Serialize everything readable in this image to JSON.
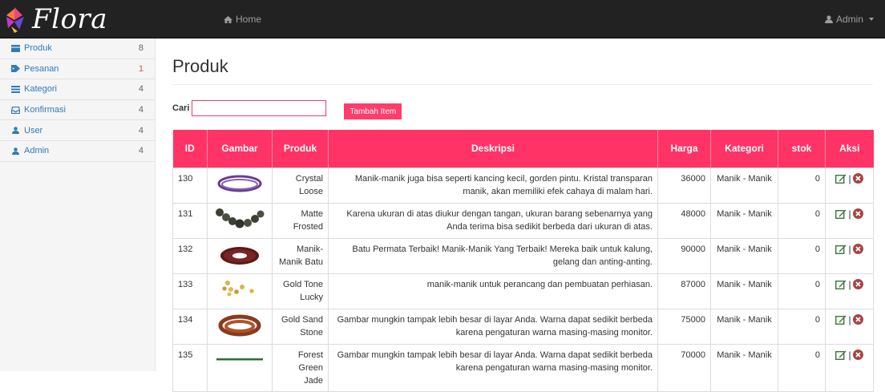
{
  "brand": {
    "name": "Flora"
  },
  "nav": {
    "home_label": "Home",
    "user_label": "Admin"
  },
  "sidebar": {
    "items": [
      {
        "label": "Produk",
        "count": "8",
        "icon": "box-icon"
      },
      {
        "label": "Pesanan",
        "count": "1",
        "icon": "tag-icon"
      },
      {
        "label": "Kategori",
        "count": "4",
        "icon": "list-icon"
      },
      {
        "label": "Konfirmasi",
        "count": "4",
        "icon": "inbox-icon"
      },
      {
        "label": "User",
        "count": "4",
        "icon": "user-icon"
      },
      {
        "label": "Admin",
        "count": "4",
        "icon": "user-icon"
      }
    ]
  },
  "main": {
    "title": "Produk",
    "search_label": "Cari",
    "search_value": "",
    "add_button": "Tambah Item",
    "columns": [
      "ID",
      "Gambar",
      "Produk",
      "Deskripsi",
      "Harga",
      "Kategori",
      "stok",
      "Aksi"
    ],
    "rows": [
      {
        "id": "130",
        "product": "Crystal Loose",
        "description": "Manik-manik juga bisa seperti kancing kecil, gorden pintu. Kristal transparan manik, akan memiliki efek cahaya di malam hari.",
        "price": "36000",
        "category": "Manik - Manik",
        "stock": "0",
        "image": "purple-bead-strand"
      },
      {
        "id": "131",
        "product": "Matte Frosted",
        "description": "Karena ukuran di atas diukur dengan tangan, ukuran barang sebenarnya yang Anda terima bisa sedikit berbeda dari ukuran di atas.",
        "price": "48000",
        "category": "Manik - Manik",
        "stock": "0",
        "image": "dark-bead-strand"
      },
      {
        "id": "132",
        "product": "Manik-Manik Batu",
        "description": "Batu Permata Terbaik! Manik-Manik Yang Terbaik! Mereka baik untuk kalung, gelang dan anting-anting.",
        "price": "90000",
        "category": "Manik - Manik",
        "stock": "0",
        "image": "red-bead-strand"
      },
      {
        "id": "133",
        "product": "Gold Tone Lucky",
        "description": "manik-manik untuk perancang dan pembuatan perhiasan.",
        "price": "87000",
        "category": "Manik - Manik",
        "stock": "0",
        "image": "gold-beads"
      },
      {
        "id": "134",
        "product": "Gold Sand Stone",
        "description": "Gambar mungkin tampak lebih besar di layar Anda. Warna dapat sedikit berbeda karena pengaturan warna masing-masing monitor.",
        "price": "75000",
        "category": "Manik - Manik",
        "stock": "0",
        "image": "goldstone-bead-strand"
      },
      {
        "id": "135",
        "product": "Forest Green Jade",
        "description": "Gambar mungkin tampak lebih besar di layar Anda. Warna dapat sedikit berbeda karena pengaturan warna masing-masing monitor.",
        "price": "70000",
        "category": "Manik - Manik",
        "stock": "0",
        "image": "green-bead-strand"
      }
    ]
  },
  "colors": {
    "accent": "#ff3366",
    "navbar": "#222222",
    "sidebar": "#f5f5f5",
    "link": "#337ab7"
  }
}
